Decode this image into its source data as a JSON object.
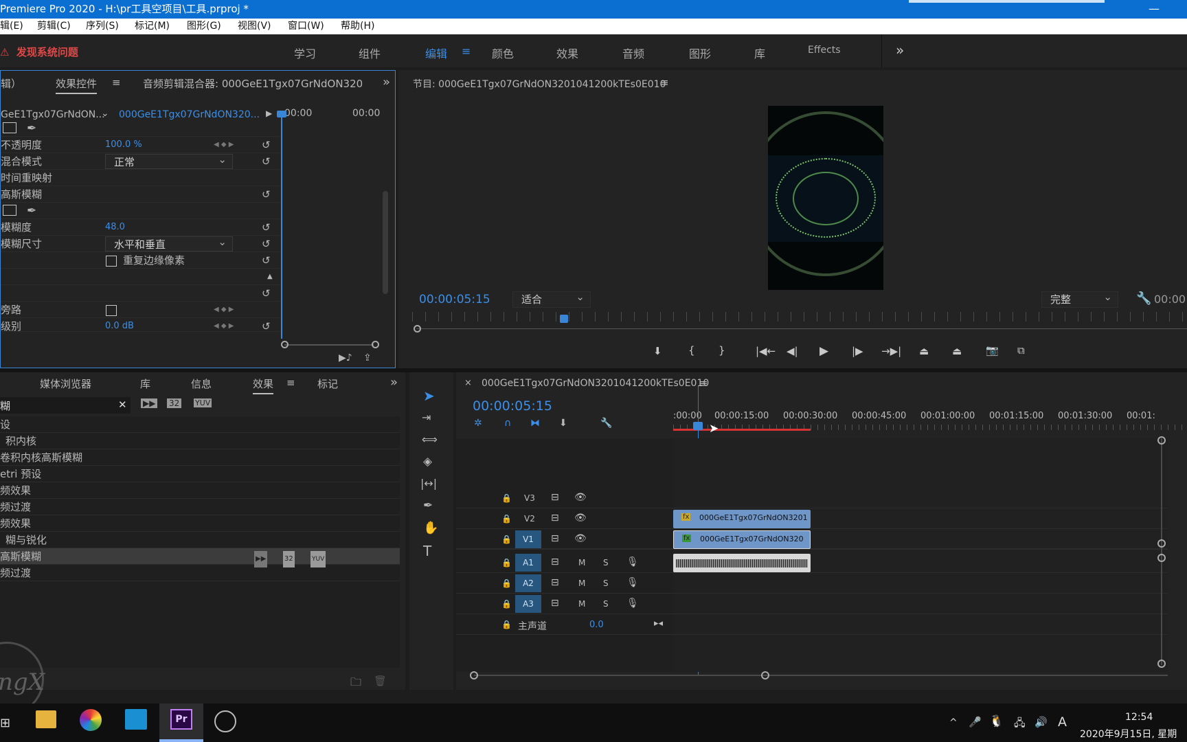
{
  "app": {
    "title": "Premiere Pro 2020 - H:\\pr工具空项目\\工具.prproj *",
    "minimize": "—"
  },
  "menu": [
    "辑(E)",
    "剪辑(C)",
    "序列(S)",
    "标记(M)",
    "图形(G)",
    "视图(V)",
    "窗口(W)",
    "帮助(H)"
  ],
  "alert": "发现系统问题",
  "workspaces": [
    "学习",
    "组件",
    "编辑",
    "颜色",
    "效果",
    "音频",
    "图形",
    "库",
    "Effects"
  ],
  "ws_more": "»",
  "effect_controls": {
    "tab_prev": "辑）",
    "tab_active": "效果控件",
    "tab_mixer": "音频剪辑混合器: 000GeE1Tgx07GrNdON3201",
    "source_clip": "GeE1Tgx07GrNdON...",
    "seq_clip": "000GeE1Tgx07GrNdON320...",
    "tl_start": "00:00",
    "tl_end": "00:00",
    "rows": {
      "opacity_label": "不透明度",
      "opacity_value": "100.0 %",
      "blend_label": "混合模式",
      "blend_value": "正常",
      "timeremap": "时间重映射",
      "blur_fx": "高斯模糊",
      "blurriness_label": "模糊度",
      "blurriness_value": "48.0",
      "dimension_label": "模糊尺寸",
      "dimension_value": "水平和垂直",
      "repeat_edge": "重复边缘像素",
      "bypass_label": "旁路",
      "level_label": "级别",
      "level_value": "0.0 dB"
    }
  },
  "program": {
    "title": "节目: 000GeE1Tgx07GrNdON3201041200kTEs0E010",
    "timecode": "00:00:05:15",
    "fit": "适合",
    "quality": "完整",
    "tc_right": "00:00"
  },
  "project": {
    "tabs": [
      "媒体浏览器",
      "库",
      "信息",
      "效果",
      "标记"
    ],
    "search": "糊",
    "items": [
      "设",
      "积内核",
      "卷积内核高斯模糊",
      "etri 预设",
      "频效果",
      "频过渡",
      "频效果",
      "糊与锐化",
      "高斯模糊",
      "频过渡"
    ],
    "badges": [
      "32",
      "YUV"
    ]
  },
  "timeline": {
    "title": "000GeE1Tgx07GrNdON3201041200kTEs0E010",
    "timecode": "00:00:05:15",
    "ruler": [
      ":00:00",
      "00:00:15:00",
      "00:00:30:00",
      "00:00:45:00",
      "00:01:00:00",
      "00:01:15:00",
      "00:01:30:00",
      "00:01:"
    ],
    "video_tracks": [
      "V3",
      "V2",
      "V1"
    ],
    "audio_tracks": [
      "A1",
      "A2",
      "A3"
    ],
    "track_m": "M",
    "track_s": "S",
    "master": "主声道",
    "master_value": "0.0",
    "clip_v2": "000GeE1Tgx07GrNdON3201",
    "clip_v1": "000GeE1Tgx07GrNdON320"
  },
  "tools": [
    "selection",
    "track-select",
    "ripple",
    "razor",
    "slip",
    "pen",
    "hand",
    "type"
  ],
  "taskbar": {
    "time": "12:54",
    "date": "2020年9月15日, 星期",
    "ime": "A"
  },
  "colors": {
    "accent": "#3b8fe8",
    "alert": "#e04747",
    "clip_video": "#6f96c8",
    "work_area": "#d83232"
  }
}
